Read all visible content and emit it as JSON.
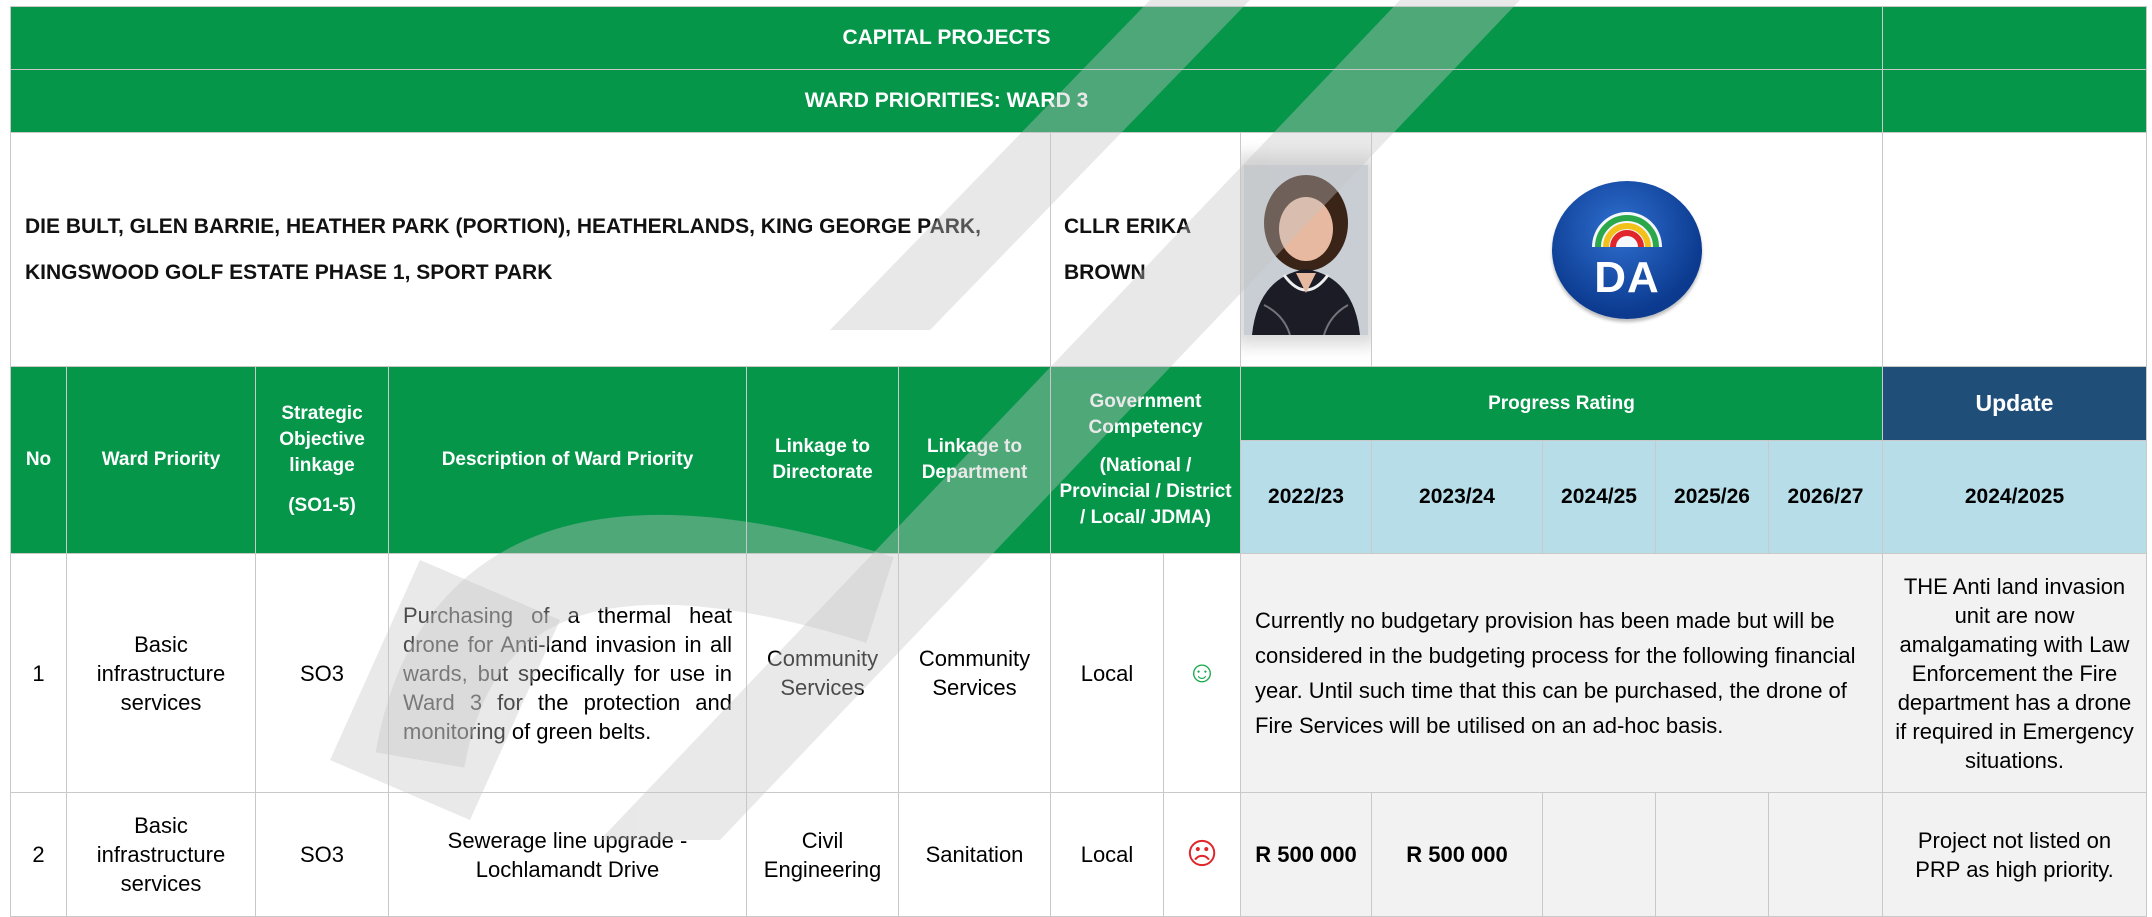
{
  "header": {
    "title": "CAPITAL PROJECTS",
    "ward_title": "WARD PRIORITIES: WARD 3",
    "areas_line1": "DIE BULT, GLEN BARRIE, HEATHER PARK (PORTION), HEATHERLANDS, KING GEORGE PARK,",
    "areas_line2": "KINGSWOOD GOLF ESTATE PHASE 1, SPORT PARK",
    "councillor": "CLLR ERIKA BROWN",
    "party_logo_text": "DA"
  },
  "columns": {
    "no": "No",
    "ward_priority": "Ward Priority",
    "strategic": "Strategic Objective linkage",
    "strategic_sub": "(SO1-5)",
    "description": "Description of Ward Priority",
    "directorate": "Linkage to Directorate",
    "department": "Linkage to Department",
    "competency": "Government Competency",
    "competency_sub": "(National / Provincial / District / Local/ JDMA)",
    "progress": "Progress Rating",
    "update": "Update",
    "years": [
      "2022/23",
      "2023/24",
      "2024/25",
      "2025/26",
      "2026/27"
    ],
    "update_year": "2024/2025"
  },
  "rows": [
    {
      "no": "1",
      "ward_priority": "Basic infrastructure services",
      "strategic": "SO3",
      "description": "Purchasing of a thermal heat drone for Anti-land invasion in all wards, but specifically for use in Ward 3 for the protection and monitoring of green belts.",
      "directorate": "Community Services",
      "department": "Community Services",
      "competency": "Local",
      "rating_icon": "smiley-face-icon",
      "progress_note": "Currently no budgetary provision has been made but will be considered in the budgeting process for the following financial year. Until such time that this can be purchased, the drone of Fire Services will be utilised on an ad-hoc basis.",
      "update": "THE Anti land invasion unit are now amalgamating with Law Enforcement the Fire department has a drone if required in Emergency situations."
    },
    {
      "no": "2",
      "ward_priority": "Basic infrastructure services",
      "strategic": "SO3",
      "description": "Sewerage line upgrade - Lochlamandt Drive",
      "directorate": "Civil Engineering",
      "department": "Sanitation",
      "competency": "Local",
      "rating_icon": "frowning-face-icon",
      "budget": [
        "R 500 000",
        "R 500 000",
        "",
        "",
        ""
      ],
      "update": "Project not listed on PRP as high priority."
    }
  ],
  "watermark_text": "DRAFT",
  "colors": {
    "header_green": "#05964a",
    "year_blue": "#b7dde8",
    "update_navy": "#1f4e79"
  }
}
